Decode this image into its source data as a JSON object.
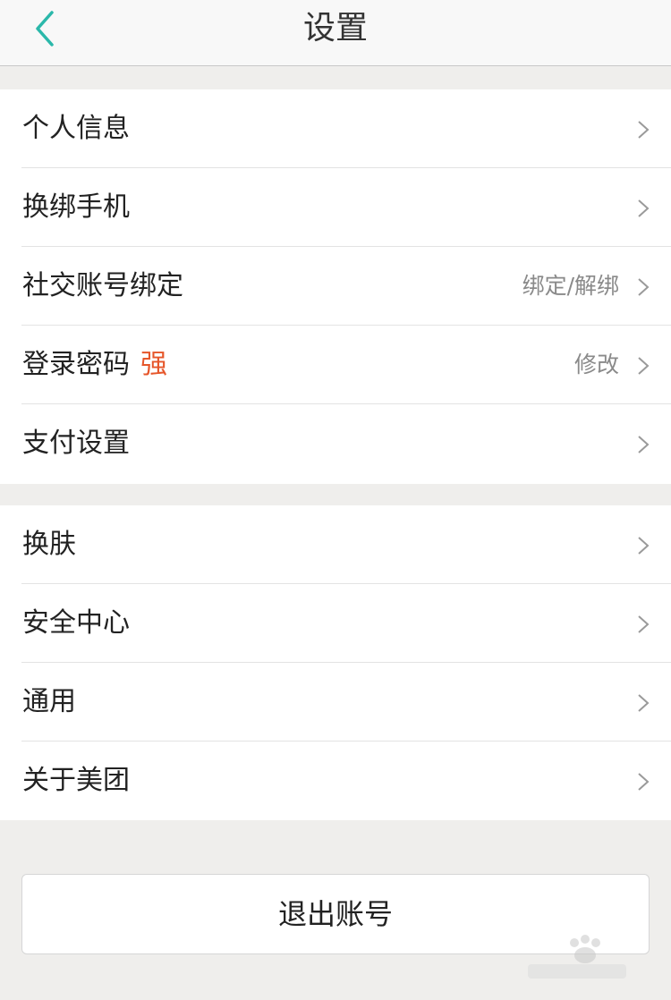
{
  "navbar": {
    "title": "设置",
    "back_icon": "chevron-left-icon",
    "accent_color": "#2bb8aa"
  },
  "group1": [
    {
      "label": "个人信息",
      "value": "",
      "tag": ""
    },
    {
      "label": "换绑手机",
      "value": "",
      "tag": ""
    },
    {
      "label": "社交账号绑定",
      "value": "绑定/解绑",
      "tag": ""
    },
    {
      "label": "登录密码",
      "value": "修改",
      "tag": "强"
    },
    {
      "label": "支付设置",
      "value": "",
      "tag": ""
    }
  ],
  "group2": [
    {
      "label": "换肤"
    },
    {
      "label": "安全中心"
    },
    {
      "label": "通用"
    },
    {
      "label": "关于美团"
    }
  ],
  "logout_label": "退出账号",
  "colors": {
    "tag_strong": "#e6562a",
    "background": "#efeeec"
  }
}
